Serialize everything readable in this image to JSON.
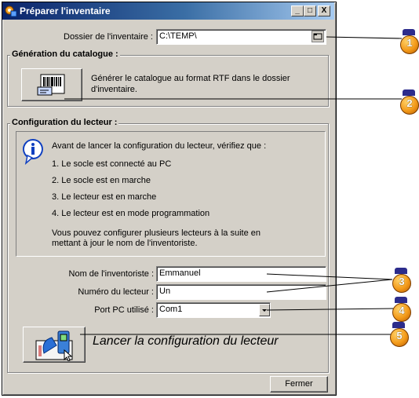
{
  "window": {
    "title": "Préparer l'inventaire"
  },
  "title_buttons": {
    "minimize": "_",
    "maximize": "□",
    "close": "X"
  },
  "folder": {
    "label": "Dossier de l'inventaire :",
    "value": "C:\\TEMP\\"
  },
  "catalog": {
    "group_title": "Génération du catalogue :",
    "description_line1": "Générer le catalogue au format RTF dans le dossier",
    "description_line2": "d'inventaire."
  },
  "reader": {
    "group_title": "Configuration du lecteur :",
    "info_intro": "Avant de lancer la configuration du lecteur, vérifiez que :",
    "checklist": [
      "1. Le socle est connecté au PC",
      "2. Le socle est en marche",
      "3. Le lecteur est en marche",
      "4. Le lecteur est en mode programmation"
    ],
    "note_line1": "Vous pouvez configurer plusieurs lecteurs à la suite en",
    "note_line2": "mettant à jour le nom de l'inventoriste."
  },
  "form": {
    "inventorist_label": "Nom de l'inventoriste :",
    "inventorist_value": "Emmanuel",
    "reader_number_label": "Numéro du lecteur :",
    "reader_number_value": "Un",
    "port_label": "Port PC utilisé :",
    "port_value": "Com1"
  },
  "launch": {
    "label": "Lancer la configuration du lecteur"
  },
  "close_button": {
    "label": "Fermer"
  },
  "callouts": [
    "1",
    "2",
    "3",
    "4",
    "5"
  ],
  "colors": {
    "titlebar_start": "#0a246a",
    "titlebar_end": "#a6caf0",
    "callout": "#f39a1a",
    "face": "#d4d0c8"
  },
  "icons": {
    "app": "app-gear-icon",
    "browse": "folder-browse-icon",
    "catalog": "barcode-catalog-icon",
    "info": "info-icon",
    "dropdown": "dropdown-arrow-icon",
    "launch": "barcode-reader-icon"
  }
}
